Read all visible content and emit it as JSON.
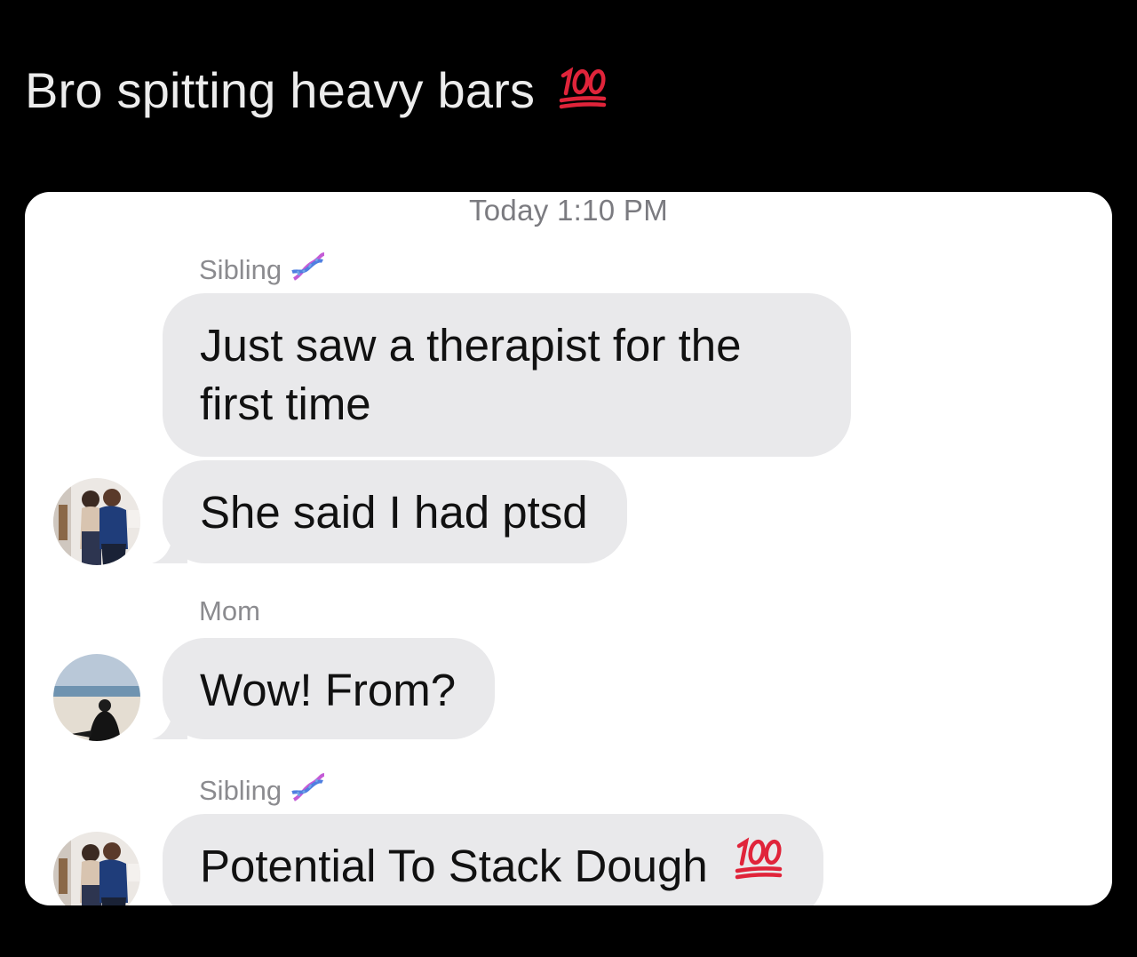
{
  "post": {
    "caption": "Bro spitting heavy bars",
    "caption_emoji": "hundred-points-emoji"
  },
  "chat": {
    "timestamp": "Today 1:10 PM",
    "groups": [
      {
        "sender": "Sibling",
        "sender_icon": "dna-icon",
        "messages": [
          "Just saw a therapist for the first time",
          "She said I had ptsd"
        ]
      },
      {
        "sender": "Mom",
        "messages": [
          "Wow! From?"
        ]
      },
      {
        "sender": "Sibling",
        "sender_icon": "dna-icon",
        "messages": [
          "Potential To Stack Dough"
        ],
        "message_emoji": "hundred-points-emoji"
      }
    ]
  },
  "colors": {
    "background": "#000000",
    "card": "#ffffff",
    "bubble": "#e9e9eb",
    "hundred_red": "#e0243a"
  }
}
